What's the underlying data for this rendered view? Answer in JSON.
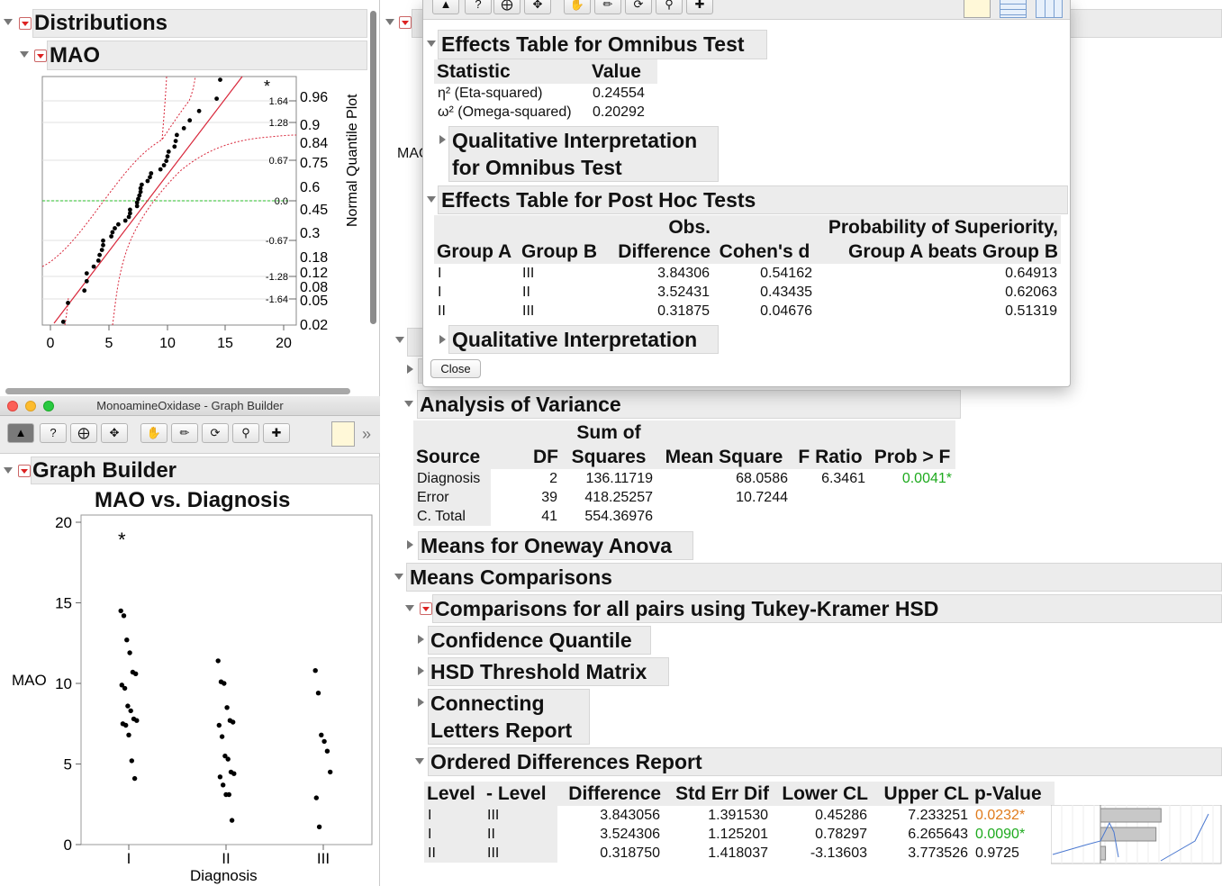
{
  "left_top": {
    "distributions_title": "Distributions",
    "mao_title": "MAO",
    "quantile_axis_label": "Normal Quantile Plot",
    "quantile_ticks": [
      "1.64",
      "1.28",
      "0.67",
      "0.0",
      "-0.67",
      "-1.28",
      "-1.64"
    ],
    "prob_ticks": [
      "0.96",
      "0.9",
      "0.84",
      "0.75",
      "0.6",
      "0.45",
      "0.3",
      "0.18",
      "0.12",
      "0.08",
      "0.05",
      "0.02"
    ],
    "x_ticks": [
      "0",
      "5",
      "10",
      "15",
      "20"
    ],
    "outlier_marker": "*"
  },
  "graph_builder": {
    "window_title": "MonoamineOxidase - Graph Builder",
    "section_title": "Graph Builder",
    "chart_title": "MAO vs. Diagnosis",
    "y_label": "MAO",
    "x_label": "Diagnosis",
    "y_ticks": [
      "20",
      "15",
      "10",
      "5",
      "0"
    ],
    "x_categories": [
      "I",
      "II",
      "III"
    ],
    "outlier_marker": "*",
    "overflow": "»"
  },
  "chart_data": {
    "type": "scatter",
    "title": "MAO vs. Diagnosis",
    "xlabel": "Diagnosis",
    "ylabel": "MAO",
    "ylim": [
      0,
      20
    ],
    "categories": [
      "I",
      "II",
      "III"
    ],
    "points": {
      "I": [
        14.5,
        14.2,
        12.7,
        11.9,
        10.7,
        10.6,
        9.9,
        9.7,
        8.6,
        8.3,
        7.8,
        7.7,
        7.5,
        7.4,
        6.8,
        5.2,
        4.1
      ],
      "II": [
        11.4,
        10.1,
        10.0,
        8.5,
        7.7,
        7.6,
        7.4,
        6.7,
        5.5,
        5.3,
        4.5,
        4.4,
        4.2,
        3.7,
        3.1,
        3.1,
        1.5
      ],
      "III": [
        10.8,
        9.4,
        6.8,
        6.4,
        5.8,
        4.5,
        2.9,
        1.1
      ]
    },
    "outlier": {
      "category": "I",
      "value": 18.7
    }
  },
  "popup": {
    "effects_omnibus_title": "Effects Table for Omnibus Test",
    "omnibus_headers": [
      "Statistic",
      "Value"
    ],
    "omnibus_rows": [
      {
        "stat": "η² (Eta-squared)",
        "value": "0.24554"
      },
      {
        "stat": "ω² (Omega-squared)",
        "value": "0.20292"
      }
    ],
    "qual_omnibus_line1": "Qualitative Interpretation",
    "qual_omnibus_line2": "for Omnibus Test",
    "posthoc_title": "Effects Table for Post Hoc Tests",
    "posthoc_headers": {
      "group_a": "Group A",
      "group_b": "Group B",
      "obs_top": "Obs.",
      "obs_bottom": "Difference",
      "cohens": "Cohen's d",
      "prob_top": "Probability of Superiority,",
      "prob_bottom": "Group A beats Group B"
    },
    "posthoc_rows": [
      {
        "a": "I",
        "b": "III",
        "diff": "3.84306",
        "d": "0.54162",
        "prob": "0.64913"
      },
      {
        "a": "I",
        "b": "II",
        "diff": "3.52431",
        "d": "0.43435",
        "prob": "0.62063"
      },
      {
        "a": "II",
        "b": "III",
        "diff": "0.31875",
        "d": "0.04676",
        "prob": "0.51319"
      }
    ],
    "qual_title": "Qualitative Interpretation",
    "close_label": "Close"
  },
  "right": {
    "mao_label_partial": "MAO",
    "anova_title": "Analysis of Variance",
    "anova_headers": {
      "source": "Source",
      "df": "DF",
      "ss_top": "Sum of",
      "ss_bottom": "Squares",
      "ms": "Mean Square",
      "f": "F Ratio",
      "p": "Prob > F"
    },
    "anova_rows": [
      {
        "source": "Diagnosis",
        "df": "2",
        "ss": "136.11719",
        "ms": "68.0586",
        "f": "6.3461",
        "p": "0.0041*"
      },
      {
        "source": "Error",
        "df": "39",
        "ss": "418.25257",
        "ms": "10.7244",
        "f": "",
        "p": ""
      },
      {
        "source": "C. Total",
        "df": "41",
        "ss": "554.36976",
        "ms": "",
        "f": "",
        "p": ""
      }
    ],
    "means_oneway_title": "Means for Oneway Anova",
    "means_comparisons_title": "Means Comparisons",
    "tukey_title": "Comparisons for all pairs using Tukey-Kramer HSD",
    "confidence_quantile_title": "Confidence Quantile",
    "hsd_matrix_title": "HSD Threshold Matrix",
    "connecting_line1": "Connecting",
    "connecting_line2": "Letters Report",
    "ordered_title": "Ordered Differences Report",
    "ordered_headers": [
      "Level",
      "- Level",
      "Difference",
      "Std Err Dif",
      "Lower CL",
      "Upper CL",
      "p-Value"
    ],
    "ordered_rows": [
      {
        "level": "I",
        "minus": "III",
        "diff": "3.843056",
        "se": "1.391530",
        "lcl": "0.45286",
        "ucl": "7.233251",
        "p": "0.0232*"
      },
      {
        "level": "I",
        "minus": "II",
        "diff": "3.524306",
        "se": "1.125201",
        "lcl": "0.78297",
        "ucl": "6.265643",
        "p": "0.0090*"
      },
      {
        "level": "II",
        "minus": "III",
        "diff": "0.318750",
        "se": "1.418037",
        "lcl": "-3.13603",
        "ucl": "3.773526",
        "p": "0.9725"
      }
    ],
    "ordered_bar_values": [
      3.843056,
      3.524306,
      0.31875
    ]
  },
  "colors": {
    "significant_green": "#1eaa1e",
    "significant_orange": "#e07b1c",
    "fit_line": "#d8263a"
  }
}
